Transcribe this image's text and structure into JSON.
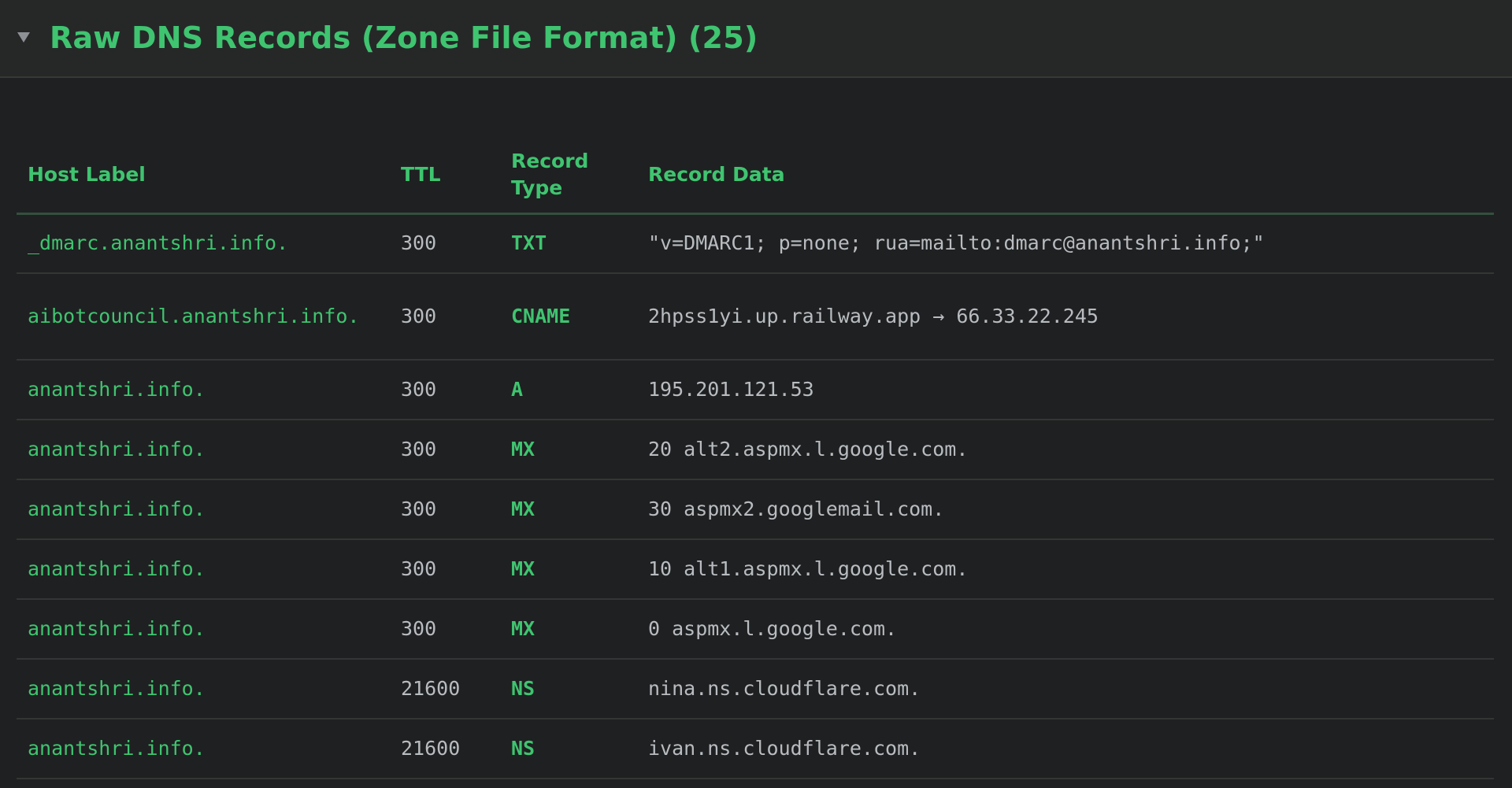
{
  "panel": {
    "title": "Raw DNS Records (Zone File Format) (25)",
    "toggle_icon": "caret-down-icon",
    "accent": "#3fc470"
  },
  "table": {
    "headers": {
      "host": "Host Label",
      "ttl": "TTL",
      "type": "Record Type",
      "data": "Record Data"
    },
    "rows": [
      {
        "host": "_dmarc.anantshri.info.",
        "ttl": "300",
        "type": "TXT",
        "data": "\"v=DMARC1; p=none; rua=mailto:dmarc@anantshri.info;\""
      },
      {
        "host": "aibotcouncil.anantshri.info.",
        "ttl": "300",
        "type": "CNAME",
        "data": "2hpss1yi.up.railway.app → 66.33.22.245"
      },
      {
        "host": "anantshri.info.",
        "ttl": "300",
        "type": "A",
        "data": "195.201.121.53"
      },
      {
        "host": "anantshri.info.",
        "ttl": "300",
        "type": "MX",
        "data": "20 alt2.aspmx.l.google.com."
      },
      {
        "host": "anantshri.info.",
        "ttl": "300",
        "type": "MX",
        "data": "30 aspmx2.googlemail.com."
      },
      {
        "host": "anantshri.info.",
        "ttl": "300",
        "type": "MX",
        "data": "10 alt1.aspmx.l.google.com."
      },
      {
        "host": "anantshri.info.",
        "ttl": "300",
        "type": "MX",
        "data": "0 aspmx.l.google.com."
      },
      {
        "host": "anantshri.info.",
        "ttl": "21600",
        "type": "NS",
        "data": "nina.ns.cloudflare.com."
      },
      {
        "host": "anantshri.info.",
        "ttl": "21600",
        "type": "NS",
        "data": "ivan.ns.cloudflare.com."
      }
    ]
  }
}
